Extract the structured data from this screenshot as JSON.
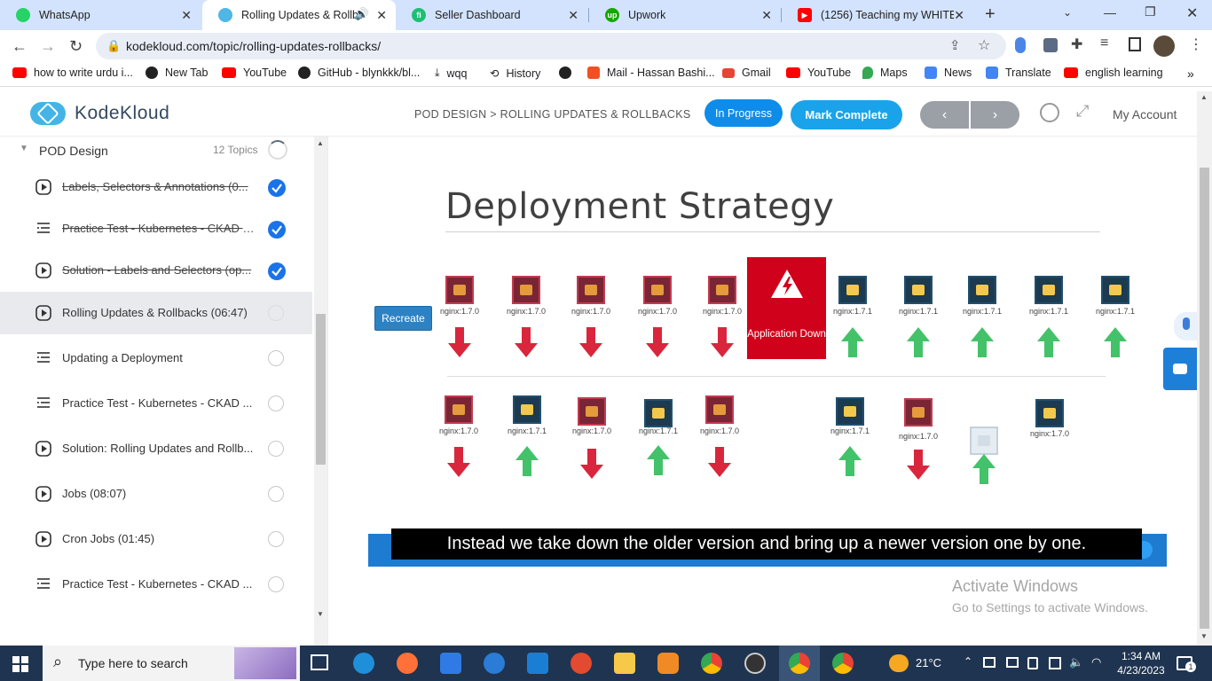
{
  "browser": {
    "tabs": [
      {
        "title": "WhatsApp",
        "color": "#25d366"
      },
      {
        "title": "Rolling Updates & Rollba",
        "color": "#4fb6e6",
        "active": true
      },
      {
        "title": "Seller Dashboard",
        "color": "#1dbf73"
      },
      {
        "title": "Upwork",
        "color": "#14a800"
      },
      {
        "title": "(1256) Teaching my WHITE fr",
        "color": "#ff0000"
      }
    ],
    "url": "kodekloud.com/topic/rolling-updates-rollbacks/",
    "bookmarks": [
      "how to write urdu i...",
      "New Tab",
      "YouTube",
      "GitHub - blynkkk/bl...",
      "wqq",
      "History",
      "",
      "Mail - Hassan Bashi...",
      "Gmail",
      "YouTube",
      "Maps",
      "News",
      "Translate",
      "english learning"
    ]
  },
  "header": {
    "logo": "KodeKloud",
    "breadcrumb": "POD DESIGN > ROLLING UPDATES & ROLLBACKS",
    "in_progress": "In Progress",
    "mark_complete": "Mark Complete",
    "prev": "‹",
    "next": "›",
    "my_account": "My Account"
  },
  "sidebar": {
    "section_title": "POD Design",
    "section_count": "12 Topics",
    "items": [
      {
        "label": "Labels, Selectors & Annotations (0...",
        "type": "video",
        "done": true
      },
      {
        "label": "Practice Test - Kubernetes - CKAD -...",
        "type": "quiz",
        "done": true
      },
      {
        "label": "Solution - Labels and Selectors (op...",
        "type": "video",
        "done": true
      },
      {
        "label": "Rolling Updates & Rollbacks (06:47)",
        "type": "video",
        "done": false,
        "current": true
      },
      {
        "label": "Updating a Deployment",
        "type": "quiz",
        "done": false
      },
      {
        "label": "Practice Test - Kubernetes - CKAD ...",
        "type": "quiz",
        "done": false
      },
      {
        "label": "Solution: Rolling Updates and Rollb...",
        "type": "video",
        "done": false
      },
      {
        "label": "Jobs (08:07)",
        "type": "video",
        "done": false
      },
      {
        "label": "Cron Jobs (01:45)",
        "type": "video",
        "done": false
      },
      {
        "label": "Practice Test - Kubernetes - CKAD ...",
        "type": "quiz",
        "done": false
      }
    ]
  },
  "slide": {
    "title": "Deployment Strategy",
    "recreate_label": "Recreate",
    "app_down_label": "Application Down",
    "row1": [
      {
        "label": "nginx:1.7.0",
        "kind": "old",
        "arrow": "down"
      },
      {
        "label": "nginx:1.7.0",
        "kind": "old",
        "arrow": "down"
      },
      {
        "label": "nginx:1.7.0",
        "kind": "old",
        "arrow": "down"
      },
      {
        "label": "nginx:1.7.0",
        "kind": "old",
        "arrow": "down"
      },
      {
        "label": "nginx:1.7.0",
        "kind": "old",
        "arrow": "down"
      },
      {
        "label": "nginx:1.7.1",
        "kind": "new",
        "arrow": "up"
      },
      {
        "label": "nginx:1.7.1",
        "kind": "new",
        "arrow": "up"
      },
      {
        "label": "nginx:1.7.1",
        "kind": "new",
        "arrow": "up"
      },
      {
        "label": "nginx:1.7.1",
        "kind": "new",
        "arrow": "up"
      },
      {
        "label": "nginx:1.7.1",
        "kind": "new",
        "arrow": "up"
      }
    ],
    "row2": [
      {
        "label": "nginx:1.7.0",
        "kind": "old",
        "arrow": "down"
      },
      {
        "label": "nginx:1.7.1",
        "kind": "new",
        "arrow": "up"
      },
      {
        "label": "nginx:1.7.0",
        "kind": "old",
        "arrow": "down"
      },
      {
        "label": "nginx:1.7.1",
        "kind": "new",
        "arrow": "up"
      },
      {
        "label": "nginx:1.7.0",
        "kind": "old",
        "arrow": "down"
      },
      {
        "label": "nginx:1.7.1",
        "kind": "new",
        "arrow": "up"
      },
      {
        "label": "nginx:1.7.0",
        "kind": "old",
        "arrow": "down"
      },
      {
        "label": "",
        "kind": "ghost",
        "arrow": "up"
      },
      {
        "label": "nginx:1.7.0",
        "kind": "new",
        "arrow": ""
      }
    ],
    "caption": "Instead we take down the older version and bring up a newer version one by one."
  },
  "watermark": {
    "line1": "Activate Windows",
    "line2": "Go to Settings to activate Windows."
  },
  "taskbar": {
    "search_placeholder": "Type here to search",
    "temperature": "21°C",
    "time": "1:34 AM",
    "date": "4/23/2023",
    "notification_count": "1"
  },
  "colors": {
    "accent": "#1aa3ea",
    "in_progress": "#0f8ce9",
    "check": "#1a73e8",
    "down_arrow": "#d9263c",
    "up_arrow": "#43c26a",
    "app_down": "#d0021b"
  }
}
